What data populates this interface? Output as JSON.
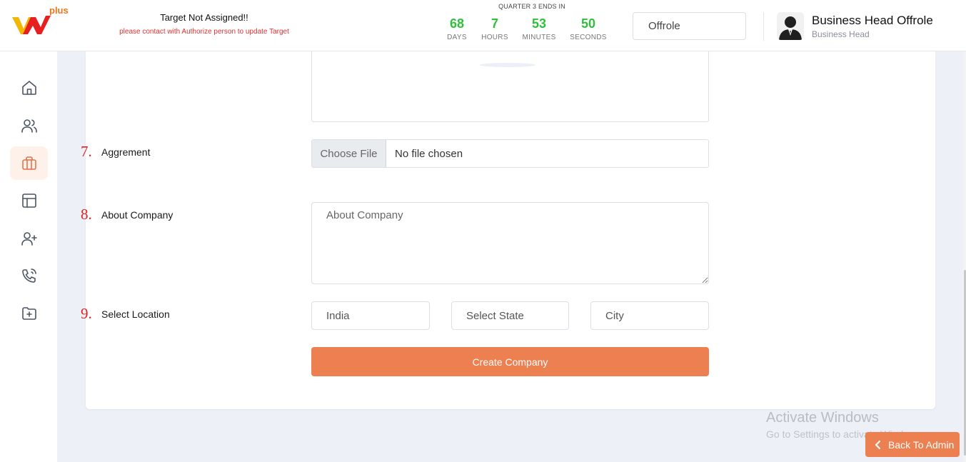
{
  "header": {
    "logo_text": "plus",
    "target_title": "Target Not Assigned!!",
    "target_subtitle": "please contact with Authorize person to update Target",
    "quarter_label": "QUARTER 3 ENDS IN",
    "countdown": [
      {
        "value": "68",
        "label": "DAYS"
      },
      {
        "value": "7",
        "label": "HOURS"
      },
      {
        "value": "53",
        "label": "MINUTES"
      },
      {
        "value": "50",
        "label": "SECONDS"
      }
    ],
    "role_select_value": "Offrole",
    "user_name": "Business Head Offrole",
    "user_role": "Business Head"
  },
  "sidebar": {
    "items": [
      {
        "icon": "home-icon",
        "active": false
      },
      {
        "icon": "users-icon",
        "active": false
      },
      {
        "icon": "briefcase-icon",
        "active": true
      },
      {
        "icon": "layout-icon",
        "active": false
      },
      {
        "icon": "user-plus-icon",
        "active": false
      },
      {
        "icon": "phone-call-icon",
        "active": false
      },
      {
        "icon": "folder-plus-icon",
        "active": false
      }
    ]
  },
  "form": {
    "agreement": {
      "number": "7.",
      "label": "Aggrement",
      "button_label": "Choose File",
      "file_status": "No file chosen"
    },
    "about": {
      "number": "8.",
      "label": "About Company",
      "placeholder": "About Company"
    },
    "location": {
      "number": "9.",
      "label": "Select Location",
      "country_value": "India",
      "state_placeholder": "Select State",
      "city_placeholder": "City"
    },
    "submit_label": "Create Company"
  },
  "watermark": {
    "line1": "Activate Windows",
    "line2": "Go to Settings to activate Windows."
  },
  "back_button_label": "Back To Admin",
  "colors": {
    "accent": "#ec8050",
    "countdown": "#2fbf3a",
    "warning": "#e53030",
    "step_number": "#e02020"
  }
}
